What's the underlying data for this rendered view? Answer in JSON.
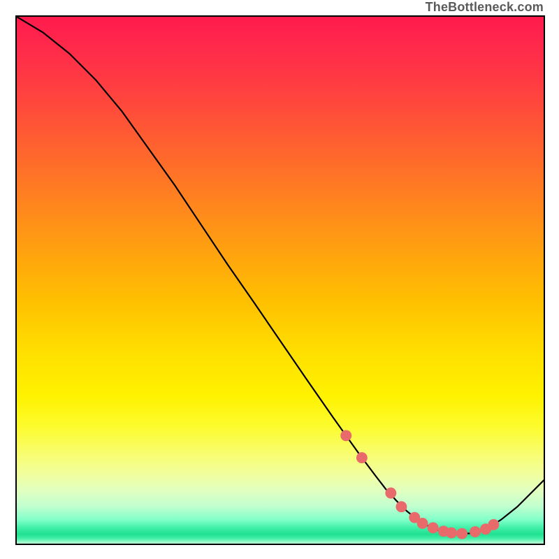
{
  "watermark": "TheBottleneck.com",
  "chart_data": {
    "type": "line",
    "title": "",
    "xlabel": "",
    "ylabel": "",
    "xlim": [
      0,
      100
    ],
    "ylim": [
      0,
      100
    ],
    "grid": false,
    "series": [
      {
        "name": "bottleneck-curve",
        "x": [
          0,
          5,
          10,
          15,
          20,
          25,
          30,
          35,
          40,
          45,
          50,
          55,
          60,
          62,
          65,
          68,
          70,
          72,
          74,
          76,
          78,
          80,
          82,
          84,
          86,
          88,
          90,
          92,
          95,
          100
        ],
        "values": [
          100,
          97,
          93,
          88,
          82,
          75,
          68,
          60.5,
          53,
          45.8,
          38.5,
          31.2,
          24,
          21.2,
          17,
          13,
          10.4,
          8.2,
          6.2,
          4.6,
          3.4,
          2.55,
          2.05,
          1.85,
          1.95,
          2.4,
          3.3,
          4.6,
          7,
          12
        ]
      }
    ],
    "markers": {
      "name": "highlight-points",
      "color": "#e86a6a",
      "x": [
        62.5,
        65.5,
        71,
        73,
        75.5,
        77,
        79,
        81,
        82.5,
        84.5,
        87,
        89,
        90.5
      ],
      "values": [
        20.5,
        16.3,
        9.6,
        7.0,
        4.95,
        3.85,
        3.0,
        2.35,
        2.05,
        1.9,
        2.25,
        2.75,
        3.6
      ]
    }
  }
}
